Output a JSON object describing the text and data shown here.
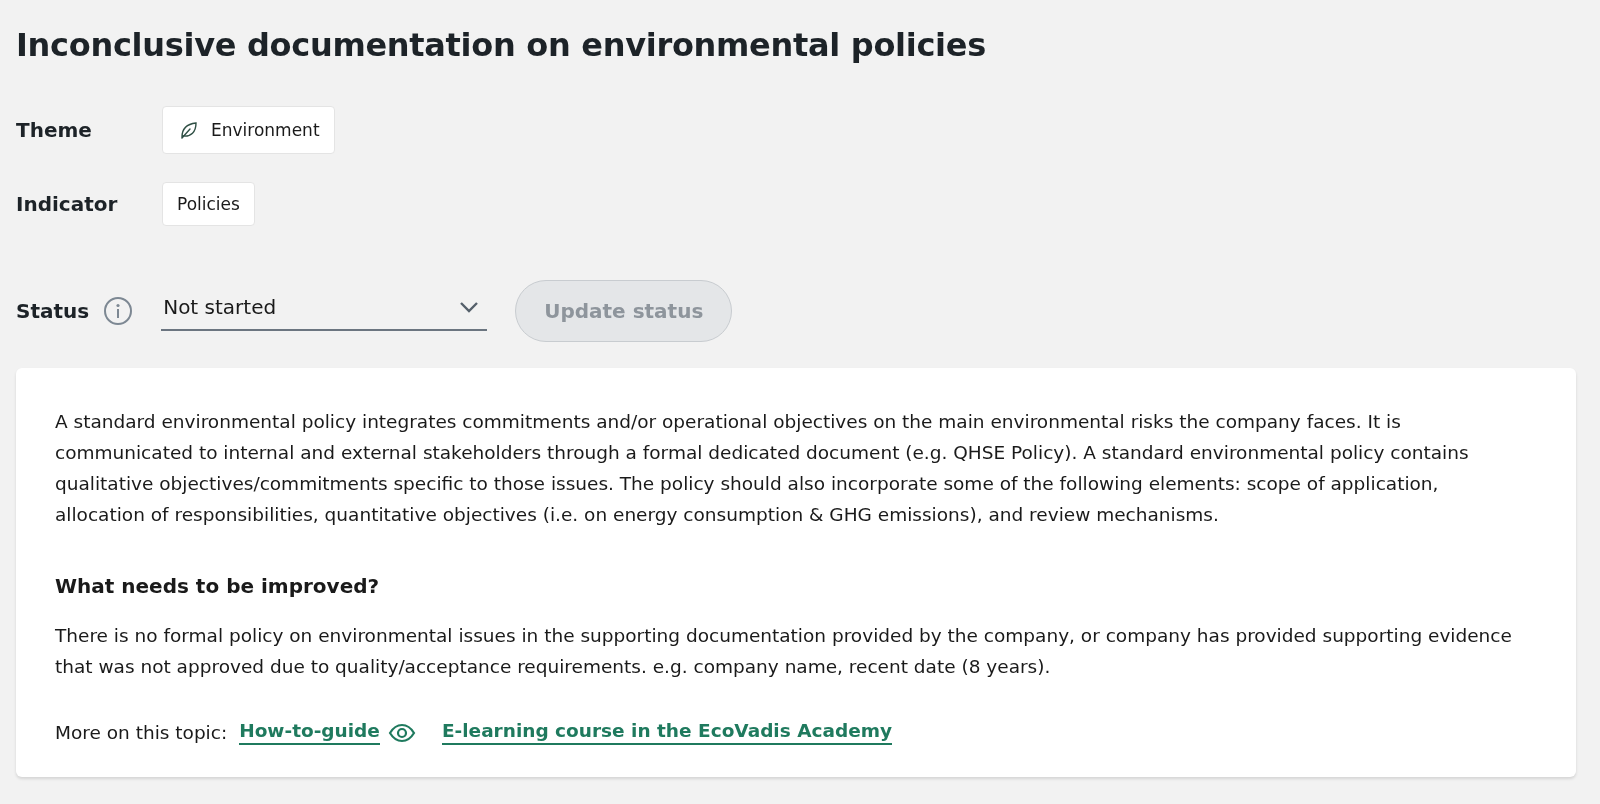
{
  "title": "Inconclusive documentation on environmental policies",
  "fields": [
    {
      "label": "Theme",
      "value": "Environment"
    },
    {
      "label": "Indicator",
      "value": "Policies"
    }
  ],
  "status": {
    "label": "Status",
    "value": "Not started",
    "button": {
      "label": "Update status",
      "disabled": true
    }
  },
  "description": "A standard environmental policy integrates commitments and/or operational objectives on the main environmental risks the company faces. It is communicated to internal and external stakeholders through a formal dedicated document (e.g. QHSE Policy). A standard environmental policy contains qualitative objectives/commitments specific to those issues. The policy should also incorporate some of the following elements: scope of application, allocation of responsibilities, quantitative objectives (i.e. on energy consumption & GHG emissions), and review mechanisms.",
  "improve": {
    "heading": "What needs to be improved?",
    "text": "There is no formal policy on environmental issues in the supporting documentation provided by the company, or company has provided supporting evidence that was not approved due to quality/acceptance requirements. e.g. company name, recent date (8 years)."
  },
  "more": {
    "label": "More on this topic:",
    "links": [
      {
        "label": "How-to-guide"
      },
      {
        "label": "E-learning course in the EcoVadis Academy"
      }
    ]
  }
}
